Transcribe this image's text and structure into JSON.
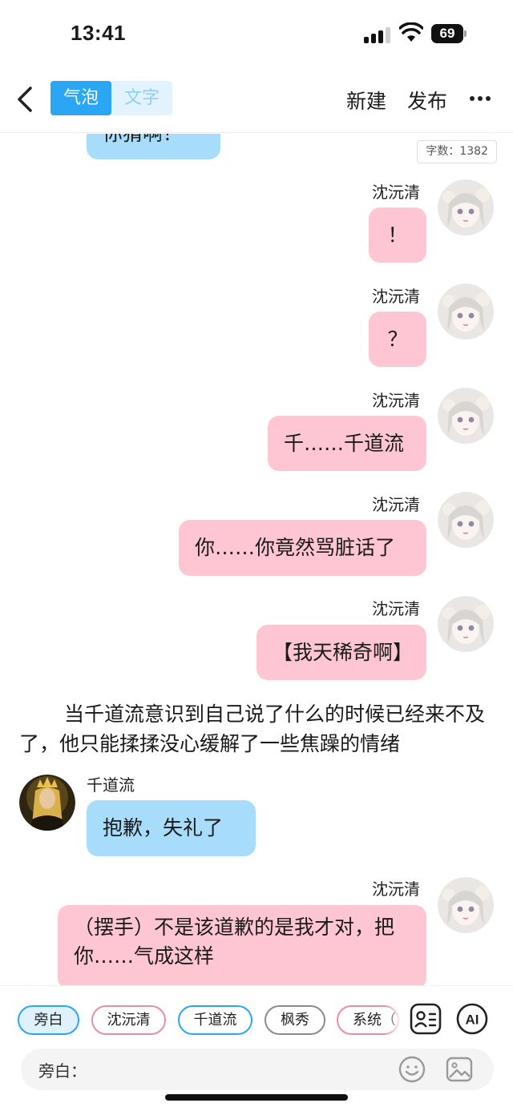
{
  "status_bar": {
    "time": "13:41",
    "battery": "69"
  },
  "nav": {
    "modes": [
      "气泡",
      "文字"
    ],
    "new_label": "新建",
    "publish_label": "发布"
  },
  "chat": {
    "char_count": "字数：1382",
    "top_partial_text": "你猜啊？",
    "messages": [
      {
        "speaker": "沈沅清",
        "side": "right",
        "text": "！"
      },
      {
        "speaker": "沈沅清",
        "side": "right",
        "text": "？"
      },
      {
        "speaker": "沈沅清",
        "side": "right",
        "text": "千……千道流"
      },
      {
        "speaker": "沈沅清",
        "side": "right",
        "text": "你……你竟然骂脏话了"
      },
      {
        "speaker": "沈沅清",
        "side": "right",
        "text": "【我天稀奇啊】"
      },
      {
        "speaker": "千道流",
        "side": "left",
        "text": "抱歉，失礼了"
      },
      {
        "speaker": "沈沅清",
        "side": "right",
        "text": "（摆手）不是该道歉的是我才对，把你……气成这样"
      }
    ],
    "narration": "当千道流意识到自己说了什么的时候已经来不及了，他只能揉揉没心缓解了一些焦躁的情绪"
  },
  "composer": {
    "roles": [
      "旁白",
      "沈沅清",
      "千道流",
      "枫秀",
      "系统（"
    ],
    "selected_role": "旁白",
    "input_label": "旁白：",
    "input_value": ""
  },
  "colors": {
    "accent": "#2aa6f5",
    "bubble_left": "#a8dcfb",
    "bubble_right": "#fdc6d2"
  }
}
